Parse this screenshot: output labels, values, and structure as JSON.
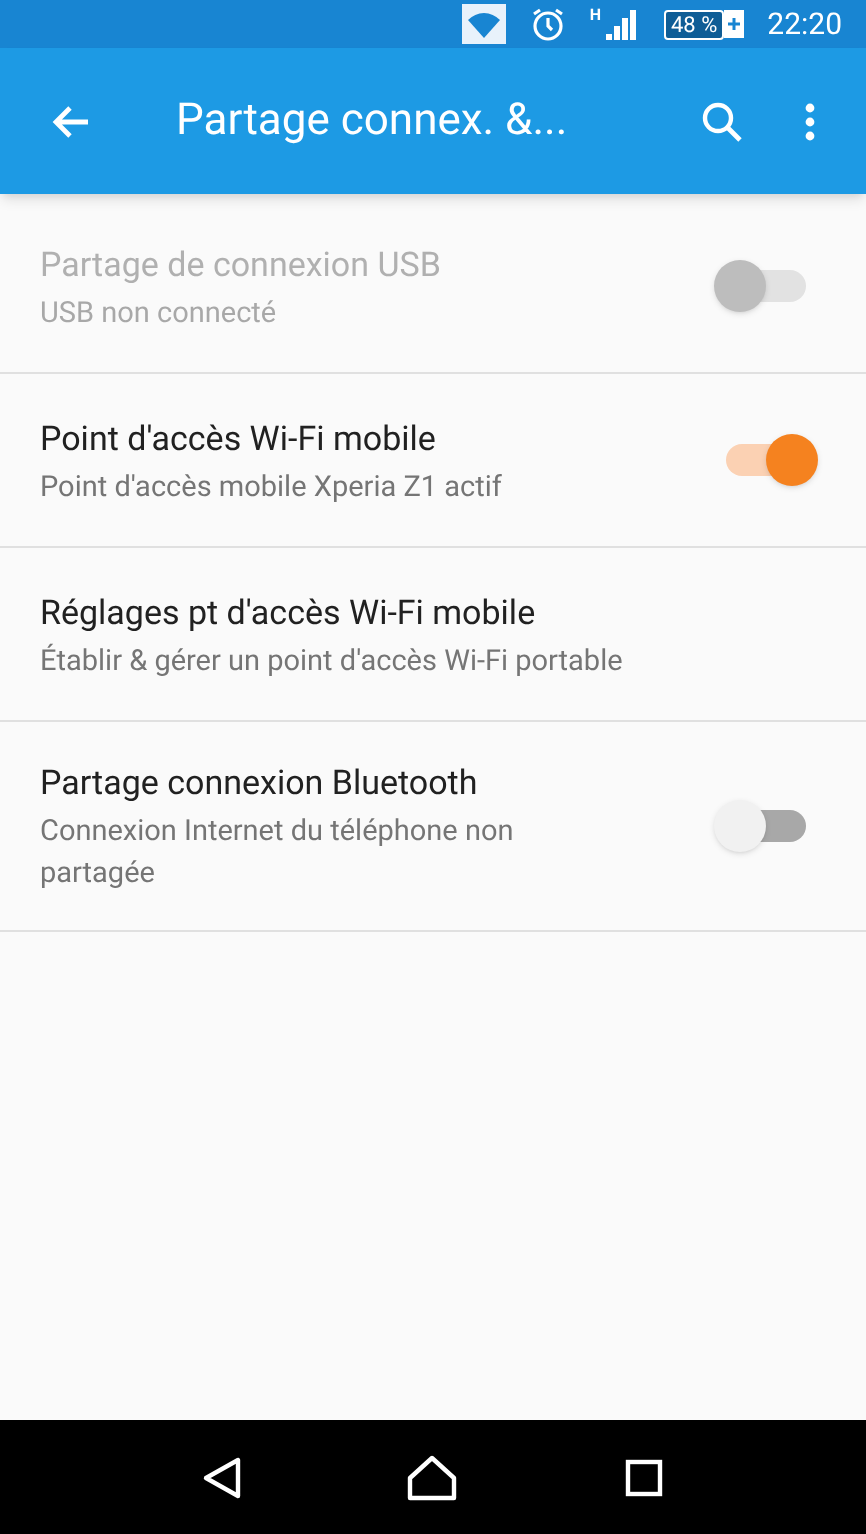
{
  "status_bar": {
    "network": "H",
    "battery": "48 %",
    "time": "22:20"
  },
  "toolbar": {
    "title": "Partage connex. &..."
  },
  "items": [
    {
      "kind": "toggle",
      "title": "Partage de connexion USB",
      "subtitle": "USB non connecté",
      "disabled": true,
      "on": false
    },
    {
      "kind": "toggle",
      "title": "Point d'accès Wi-Fi mobile",
      "subtitle": "Point d'accès mobile Xperia Z1 actif",
      "disabled": false,
      "on": true
    },
    {
      "kind": "plain",
      "title": "Réglages pt d'accès Wi-Fi mobile",
      "subtitle": "Établir & gérer un point d'accès Wi-Fi portable",
      "disabled": false
    },
    {
      "kind": "toggle",
      "title": "Partage connexion Bluetooth",
      "subtitle": "Connexion Internet du téléphone non partagée",
      "disabled": false,
      "on": false
    }
  ]
}
